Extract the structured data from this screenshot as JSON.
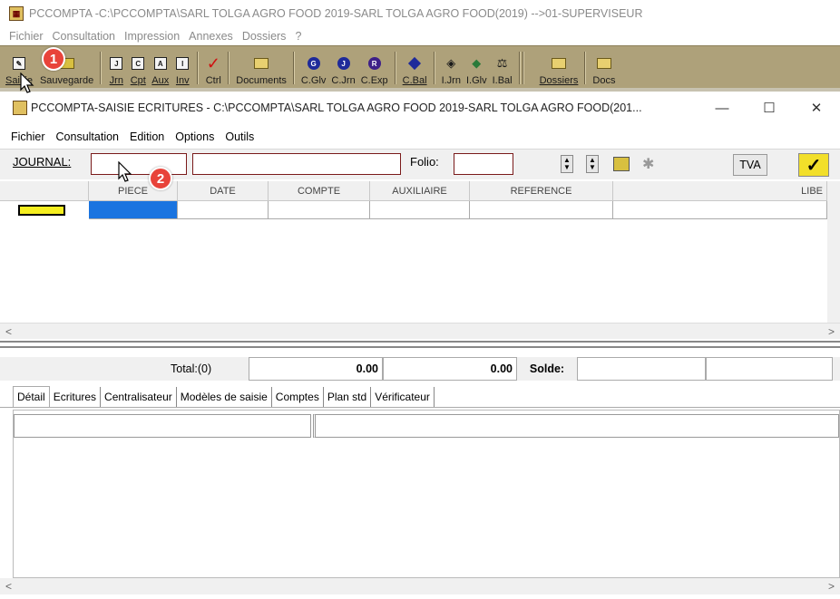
{
  "outer_window": {
    "title": "PCCOMPTA -C:\\PCCOMPTA\\SARL TOLGA AGRO FOOD 2019-SARL TOLGA  AGRO FOOD(2019) -->01-SUPERVISEUR",
    "menu": [
      "Fichier",
      "Consultation",
      "Impression",
      "Annexes",
      "Dossiers",
      "?"
    ]
  },
  "toolbar": {
    "buttons": [
      {
        "label": "Saisie",
        "icon": "pencil-icon"
      },
      {
        "label": "Sauvegarde",
        "icon": "save-icon"
      },
      {
        "label": "Jrn",
        "icon": "journal-icon"
      },
      {
        "label": "Cpt",
        "icon": "account-icon"
      },
      {
        "label": "Aux",
        "icon": "auxiliary-icon"
      },
      {
        "label": "Inv",
        "icon": "inventory-icon"
      },
      {
        "label": "Ctrl",
        "icon": "checkmark-icon"
      },
      {
        "label": "Documents",
        "icon": "documents-icon"
      },
      {
        "label": "C.Glv",
        "icon": "circle-g-icon"
      },
      {
        "label": "C.Jrn",
        "icon": "circle-j-icon"
      },
      {
        "label": "C.Exp",
        "icon": "circle-r-icon"
      },
      {
        "label": "C.Bal",
        "icon": "diamond-icon"
      },
      {
        "label": "I.Jrn",
        "icon": "print-journal-icon"
      },
      {
        "label": "I.Glv",
        "icon": "print-ledger-icon"
      },
      {
        "label": "I.Bal",
        "icon": "balance-scale-icon"
      },
      {
        "label": "Dossiers",
        "icon": "folder-icon"
      },
      {
        "label": "Docs",
        "icon": "docs-icon"
      }
    ]
  },
  "badges": {
    "one": "1",
    "two": "2"
  },
  "inner_window": {
    "title": "PCCOMPTA-SAISIE ECRITURES - C:\\PCCOMPTA\\SARL TOLGA AGRO FOOD 2019-SARL TOLGA  AGRO FOOD(201...",
    "minimize": "—",
    "maximize": "☐",
    "close": "✕",
    "menu": [
      "Fichier",
      "Consultation",
      "Edition",
      "Options",
      "Outils"
    ]
  },
  "journal": {
    "label": "JOURNAL:",
    "code_value": "",
    "name_value": "",
    "folio_label": "Folio:",
    "folio_value": "",
    "tva_label": "TVA",
    "validate_symbol": "✓"
  },
  "grid": {
    "columns": [
      "PIECE",
      "DATE",
      "COMPTE",
      "AUXILIAIRE",
      "REFERENCE",
      "LIBE"
    ]
  },
  "totals": {
    "label": "Total:(0)",
    "debit": "0.00",
    "credit": "0.00",
    "solde_label": "Solde:",
    "solde_value": ""
  },
  "tabs": [
    "Détail",
    "Ecritures",
    "Centralisateur",
    "Modèles de saisie",
    "Comptes",
    "Plan std",
    "Vérificateur"
  ],
  "colors": {
    "toolbar_bg": "#aea17a",
    "badge": "#e8433a",
    "validate_bg": "#f2df2a",
    "row_marker": "#f5ee20"
  }
}
